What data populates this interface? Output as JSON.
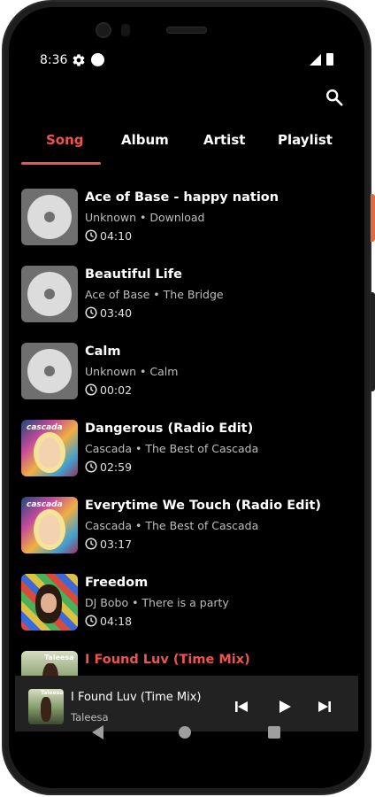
{
  "status_bar": {
    "time": "8:36"
  },
  "tabs": [
    {
      "label": "Song",
      "active": true
    },
    {
      "label": "Album",
      "active": false
    },
    {
      "label": "Artist",
      "active": false
    },
    {
      "label": "Playlist",
      "active": false
    }
  ],
  "songs": [
    {
      "title": "Ace of Base - happy nation",
      "subtitle": "Unknown • Download",
      "duration": "04:10",
      "cover": "disc-placeholder"
    },
    {
      "title": "Beautiful Life",
      "subtitle": "Ace of Base • The Bridge",
      "duration": "03:40",
      "cover": "disc-placeholder"
    },
    {
      "title": "Calm",
      "subtitle": "Unknown • Calm",
      "duration": "00:02",
      "cover": "disc-placeholder"
    },
    {
      "title": "Dangerous (Radio Edit)",
      "subtitle": "Cascada • The Best of Cascada",
      "duration": "02:59",
      "cover": "cascada-album-art",
      "cover_text": "cascada"
    },
    {
      "title": "Everytime We Touch (Radio Edit)",
      "subtitle": "Cascada • The Best of Cascada",
      "duration": "03:17",
      "cover": "cascada-album-art",
      "cover_text": "cascada"
    },
    {
      "title": "Freedom",
      "subtitle": "DJ Bobo • There is a party",
      "duration": "04:18",
      "cover": "djbobo-album-art"
    },
    {
      "title": "I Found Luv (Time Mix)",
      "subtitle": "",
      "duration": "",
      "cover": "taleesa-album-art",
      "cover_text": "Taleesa",
      "now_playing": true
    }
  ],
  "mini_player": {
    "title": "I Found Luv (Time Mix)",
    "artist": "Taleesa",
    "cover_text": "Taleesa"
  },
  "colors": {
    "accent": "#ef5350",
    "background": "#000000",
    "mini_player_bg": "#222222",
    "secondary_text": "#bdbdbd"
  },
  "icons": [
    "settings-gear-icon",
    "notification-dot-icon",
    "signal-icon",
    "battery-icon",
    "search-icon",
    "clock-icon",
    "skip-previous-icon",
    "play-icon",
    "skip-next-icon",
    "nav-back-icon",
    "nav-home-icon",
    "nav-recents-icon"
  ]
}
